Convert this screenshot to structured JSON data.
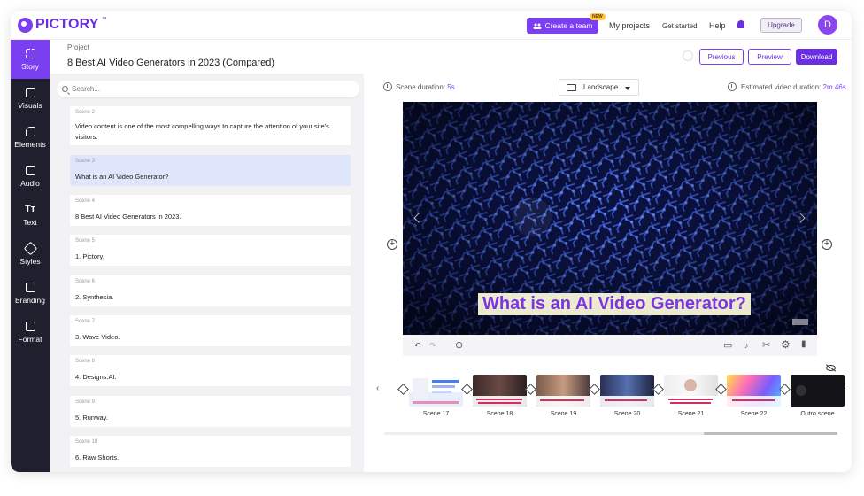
{
  "app": {
    "name": "PICTORY",
    "trademark": "™"
  },
  "topbar": {
    "create_team": "Create a team",
    "new_badge": "NEW",
    "links": [
      "My projects",
      "Get started",
      "Help"
    ],
    "upgrade": "Upgrade",
    "avatar_initial": "D"
  },
  "nav": {
    "items": [
      {
        "label": "Story",
        "icon": "story-grid-icon"
      },
      {
        "label": "Visuals",
        "icon": "image-icon"
      },
      {
        "label": "Elements",
        "icon": "shapes-icon"
      },
      {
        "label": "Audio",
        "icon": "music-icon"
      },
      {
        "label": "Text",
        "icon": "text-icon"
      },
      {
        "label": "Styles",
        "icon": "styles-icon"
      },
      {
        "label": "Branding",
        "icon": "briefcase-icon"
      },
      {
        "label": "Format",
        "icon": "format-icon"
      }
    ]
  },
  "header": {
    "project_label": "Project",
    "project_title": "8 Best AI Video Generators in 2023 (Compared)",
    "previous": "Previous",
    "preview": "Preview",
    "download": "Download"
  },
  "scenes": {
    "search_placeholder": "Search...",
    "items": [
      {
        "num": "Scene 2",
        "text": "Video content is one of the most compelling ways to capture the attention of your site's visitors."
      },
      {
        "num": "Scene 3",
        "text": "What is an AI Video Generator?"
      },
      {
        "num": "Scene 4",
        "text": "8 Best AI Video Generators in 2023."
      },
      {
        "num": "Scene 5",
        "text": "1. Pictory."
      },
      {
        "num": "Scene 6",
        "text": "2. Synthesia."
      },
      {
        "num": "Scene 7",
        "text": "3. Wave Video."
      },
      {
        "num": "Scene 8",
        "text": "4. Designs.AI."
      },
      {
        "num": "Scene 9",
        "text": "5. Runway."
      },
      {
        "num": "Scene 10",
        "text": "6. Raw Shorts."
      }
    ]
  },
  "editor": {
    "scene_duration_label": "Scene duration:",
    "scene_duration_value": "5s",
    "orientation": "Landscape",
    "estimated_label": "Estimated video duration:",
    "estimated_value": "2m 46s",
    "caption": "What is an AI Video Generator?"
  },
  "timeline": {
    "thumbs": [
      {
        "label": "Scene 17"
      },
      {
        "label": "Scene 18"
      },
      {
        "label": "Scene 19"
      },
      {
        "label": "Scene 20"
      },
      {
        "label": "Scene 21"
      },
      {
        "label": "Scene 22"
      },
      {
        "label": "Outro scene"
      }
    ]
  },
  "colors": {
    "brand": "#7b3ff2",
    "nav_bg": "#1f1f2e",
    "selected_scene": "#dfe5fb"
  }
}
